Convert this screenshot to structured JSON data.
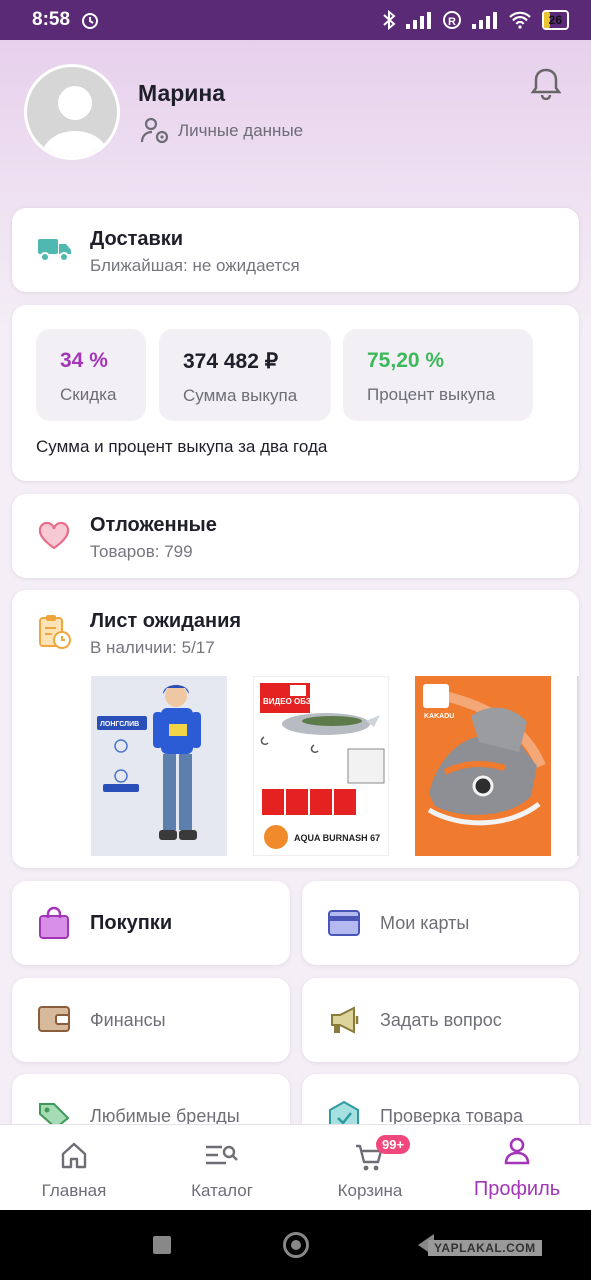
{
  "status_bar": {
    "time": "8:58",
    "battery": "26"
  },
  "profile": {
    "name": "Марина",
    "personal_link": "Личные данные"
  },
  "delivery": {
    "title": "Доставки",
    "subtitle": "Ближайшая: не ожидается"
  },
  "stats": {
    "items": [
      {
        "value": "34 %",
        "label": "Скидка",
        "color": "#a335b8"
      },
      {
        "value": "374 482 ₽",
        "label": "Сумма выкупа",
        "color": "#1f1f2a"
      },
      {
        "value": "75,20 %",
        "label": "Процент выкупа",
        "color": "#3cb95a"
      }
    ],
    "note": "Сумма и процент выкупа за два года"
  },
  "favorites": {
    "title": "Отложенные",
    "subtitle": "Товаров: 799"
  },
  "waitlist": {
    "title": "Лист ожидания",
    "subtitle": "В наличии: 5/17",
    "products": [
      {
        "badge_text": "ЛОНГСЛИВ"
      },
      {
        "badge_text": "ВИДЕО ОБЗОР",
        "caption": "AQUA BURNASH 67"
      },
      {
        "badge_text": "KAKADU"
      }
    ]
  },
  "tiles": [
    {
      "label": "Покупки"
    },
    {
      "label": "Мои карты"
    },
    {
      "label": "Финансы"
    },
    {
      "label": "Задать вопрос"
    },
    {
      "label": "Любимые бренды"
    },
    {
      "label": "Проверка товара"
    }
  ],
  "bottom_nav": {
    "items": [
      {
        "label": "Главная"
      },
      {
        "label": "Каталог"
      },
      {
        "label": "Корзина",
        "badge": "99+"
      },
      {
        "label": "Профиль"
      }
    ],
    "active_color": "#a335b8"
  },
  "watermark": "YAPLAKAL.COM"
}
